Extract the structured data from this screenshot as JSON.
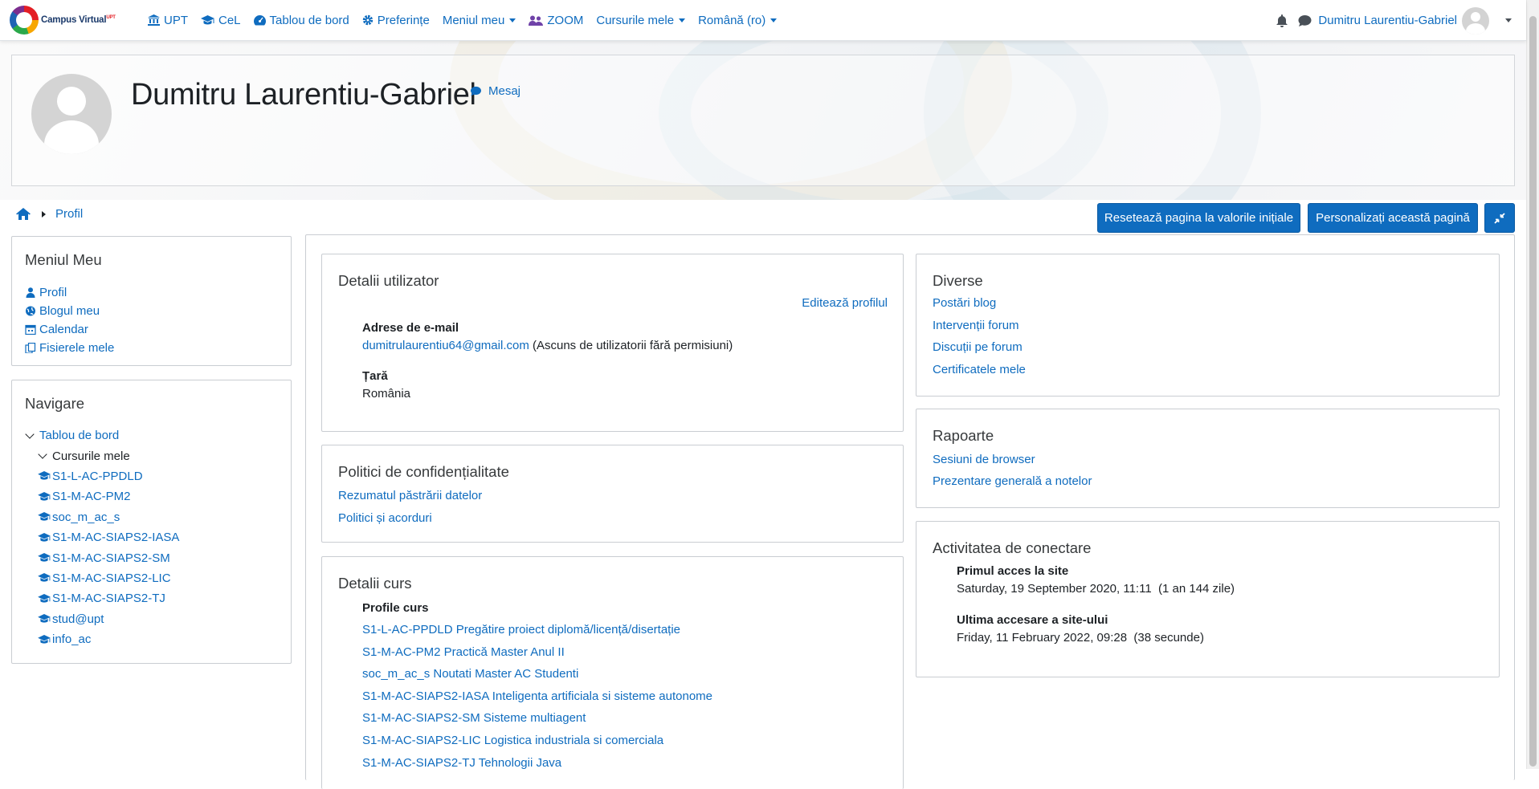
{
  "navbar": {
    "brand": "Campus Virtual",
    "brand_sup": "UPT",
    "items": [
      {
        "label": "UPT",
        "icon": "institution-icon"
      },
      {
        "label": "CeL",
        "icon": "graduation-cap-icon"
      },
      {
        "label": "Tablou de bord",
        "icon": "dashboard-icon"
      },
      {
        "label": "Preferințe",
        "icon": "gear-icon"
      },
      {
        "label": "Meniul meu",
        "dropdown": true
      },
      {
        "label": "ZOOM",
        "icon": "users-icon"
      },
      {
        "label": "Cursurile mele",
        "dropdown": true
      },
      {
        "label": "Română (ro)",
        "dropdown": true
      }
    ],
    "user_name": "Dumitru Laurentiu-Gabriel"
  },
  "header": {
    "name": "Dumitru Laurentiu-Gabriel",
    "message_link": "Mesaj"
  },
  "breadcrumb": {
    "current": "Profil"
  },
  "buttons": {
    "reset": "Resetează pagina la valorile inițiale",
    "customize": "Personalizați această pagină"
  },
  "menu_block": {
    "title": "Meniul Meu",
    "items": [
      "Profil",
      "Blogul meu",
      "Calendar",
      "Fisierele mele"
    ]
  },
  "nav_block": {
    "title": "Navigare",
    "dashboard": "Tablou de bord",
    "my_courses": "Cursurile mele",
    "courses": [
      "S1-L-AC-PPDLD",
      "S1-M-AC-PM2",
      "soc_m_ac_s",
      "S1-M-AC-SIAPS2-IASA",
      "S1-M-AC-SIAPS2-SM",
      "S1-M-AC-SIAPS2-LIC",
      "S1-M-AC-SIAPS2-TJ",
      "stud@upt",
      "info_ac"
    ]
  },
  "user_details": {
    "title": "Detalii utilizator",
    "edit_link": "Editează profilul",
    "email_label": "Adrese de e-mail",
    "email": "dumitrulaurentiu64@gmail.com",
    "email_note": "(Ascuns de utilizatorii fără permisiuni)",
    "country_label": "Țară",
    "country": "România"
  },
  "privacy": {
    "title": "Politici de confidențialitate",
    "links": [
      "Rezumatul păstrării datelor",
      "Politici și acorduri"
    ]
  },
  "course_details": {
    "title": "Detalii curs",
    "label": "Profile curs",
    "courses": [
      "S1-L-AC-PPDLD Pregătire proiect diplomă/licență/disertație",
      "S1-M-AC-PM2 Practică Master Anul II",
      "soc_m_ac_s Noutati Master AC Studenti",
      "S1-M-AC-SIAPS2-IASA Inteligenta artificiala si sisteme autonome",
      "S1-M-AC-SIAPS2-SM Sisteme multiagent",
      "S1-M-AC-SIAPS2-LIC Logistica industriala si comerciala",
      "S1-M-AC-SIAPS2-TJ Tehnologii Java"
    ]
  },
  "misc": {
    "title": "Diverse",
    "links": [
      "Postări blog",
      "Intervenții forum",
      "Discuții pe forum",
      "Certificatele mele"
    ]
  },
  "reports": {
    "title": "Rapoarte",
    "links": [
      "Sesiuni de browser",
      "Prezentare generală a notelor"
    ]
  },
  "login_activity": {
    "title": "Activitatea de conectare",
    "first_label": "Primul acces la site",
    "first_value": "Saturday, 19 September 2020, 11:11  (1 an 144 zile)",
    "last_label": "Ultima accesare a site-ului",
    "last_value": "Friday, 11 February 2022, 09:28  (38 secunde)"
  }
}
